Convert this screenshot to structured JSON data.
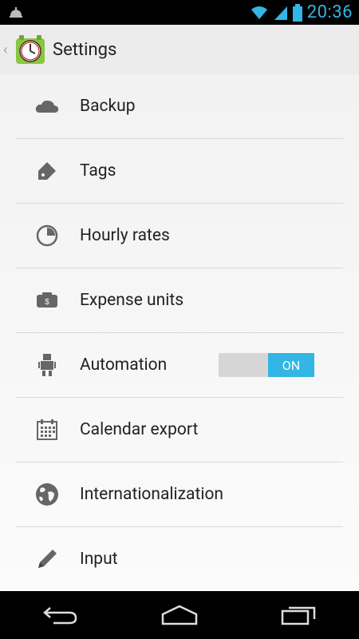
{
  "status_bar": {
    "time": "20:36"
  },
  "action_bar": {
    "title": "Settings"
  },
  "settings": {
    "items": [
      {
        "label": "Backup"
      },
      {
        "label": "Tags"
      },
      {
        "label": "Hourly rates"
      },
      {
        "label": "Expense units"
      },
      {
        "label": "Automation",
        "toggle_label": "ON"
      },
      {
        "label": "Calendar export"
      },
      {
        "label": "Internationalization"
      },
      {
        "label": "Input"
      }
    ]
  },
  "colors": {
    "accent": "#33b5e5",
    "background": "#f2f2f2",
    "status_bar": "#000000"
  },
  "icons": [
    "notification-bell-icon",
    "wifi-icon",
    "signal-icon",
    "battery-icon",
    "cloud-icon",
    "tag-icon",
    "clock-icon",
    "money-icon",
    "robot-icon",
    "calendar-icon",
    "globe-icon",
    "pencil-icon",
    "back-icon",
    "home-icon",
    "recent-apps-icon"
  ]
}
